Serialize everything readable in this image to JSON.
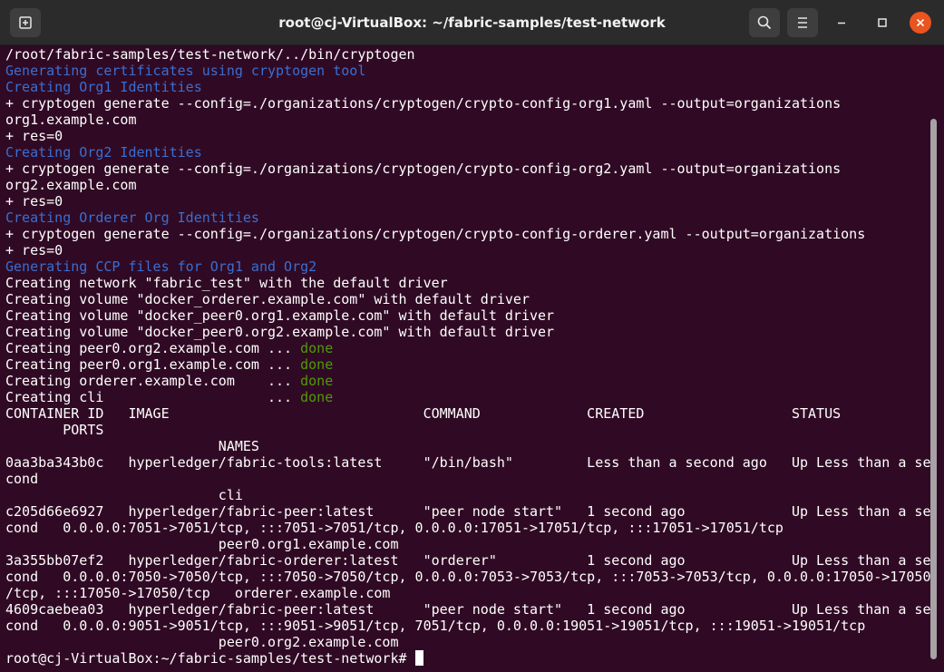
{
  "window": {
    "title": "root@cj-VirtualBox: ~/fabric-samples/test-network",
    "new_tab_icon": "new-tab-icon",
    "search_icon": "search-icon",
    "menu_icon": "hamburger-menu-icon"
  },
  "colors": {
    "background": "#300a24",
    "text": "#ffffff",
    "info": "#3a6ed1",
    "done": "#4e9a06",
    "close": "#e95420"
  },
  "terminal": {
    "lines": [
      {
        "t": "/root/fabric-samples/test-network/../bin/cryptogen"
      },
      {
        "t": "Generating certificates using cryptogen tool",
        "c": "info"
      },
      {
        "t": "Creating Org1 Identities",
        "c": "info"
      },
      {
        "t": "+ cryptogen generate --config=./organizations/cryptogen/crypto-config-org1.yaml --output=organizations"
      },
      {
        "t": "org1.example.com"
      },
      {
        "t": "+ res=0"
      },
      {
        "t": "Creating Org2 Identities",
        "c": "info"
      },
      {
        "t": "+ cryptogen generate --config=./organizations/cryptogen/crypto-config-org2.yaml --output=organizations"
      },
      {
        "t": "org2.example.com"
      },
      {
        "t": "+ res=0"
      },
      {
        "t": "Creating Orderer Org Identities",
        "c": "info"
      },
      {
        "t": "+ cryptogen generate --config=./organizations/cryptogen/crypto-config-orderer.yaml --output=organizations"
      },
      {
        "t": "+ res=0"
      },
      {
        "t": "Generating CCP files for Org1 and Org2",
        "c": "info"
      },
      {
        "t": "Creating network \"fabric_test\" with the default driver"
      },
      {
        "t": "Creating volume \"docker_orderer.example.com\" with default driver"
      },
      {
        "t": "Creating volume \"docker_peer0.org1.example.com\" with default driver"
      },
      {
        "t": "Creating volume \"docker_peer0.org2.example.com\" with default driver"
      },
      {
        "t": "Creating peer0.org2.example.com ... ",
        "d": "done"
      },
      {
        "t": "Creating peer0.org1.example.com ... ",
        "d": "done"
      },
      {
        "t": "Creating orderer.example.com    ... ",
        "d": "done"
      },
      {
        "t": "Creating cli                    ... ",
        "d": "done"
      },
      {
        "t": "CONTAINER ID   IMAGE                               COMMAND             CREATED                  STATUS"
      },
      {
        "t": "       PORTS"
      },
      {
        "t": "                          NAMES"
      },
      {
        "t": "0aa3ba343b0c   hyperledger/fabric-tools:latest     \"/bin/bash\"         Less than a second ago   Up Less than a se"
      },
      {
        "t": "cond"
      },
      {
        "t": "                          cli"
      },
      {
        "t": "c205d66e6927   hyperledger/fabric-peer:latest      \"peer node start\"   1 second ago             Up Less than a se"
      },
      {
        "t": "cond   0.0.0.0:7051->7051/tcp, :::7051->7051/tcp, 0.0.0.0:17051->17051/tcp, :::17051->17051/tcp"
      },
      {
        "t": "                          peer0.org1.example.com"
      },
      {
        "t": "3a355bb07ef2   hyperledger/fabric-orderer:latest   \"orderer\"           1 second ago             Up Less than a se"
      },
      {
        "t": "cond   0.0.0.0:7050->7050/tcp, :::7050->7050/tcp, 0.0.0.0:7053->7053/tcp, :::7053->7053/tcp, 0.0.0.0:17050->17050"
      },
      {
        "t": "/tcp, :::17050->17050/tcp   orderer.example.com"
      },
      {
        "t": "4609caebea03   hyperledger/fabric-peer:latest      \"peer node start\"   1 second ago             Up Less than a se"
      },
      {
        "t": "cond   0.0.0.0:9051->9051/tcp, :::9051->9051/tcp, 7051/tcp, 0.0.0.0:19051->19051/tcp, :::19051->19051/tcp"
      },
      {
        "t": "                          peer0.org2.example.com"
      }
    ],
    "prompt": "root@cj-VirtualBox:~/fabric-samples/test-network# "
  }
}
